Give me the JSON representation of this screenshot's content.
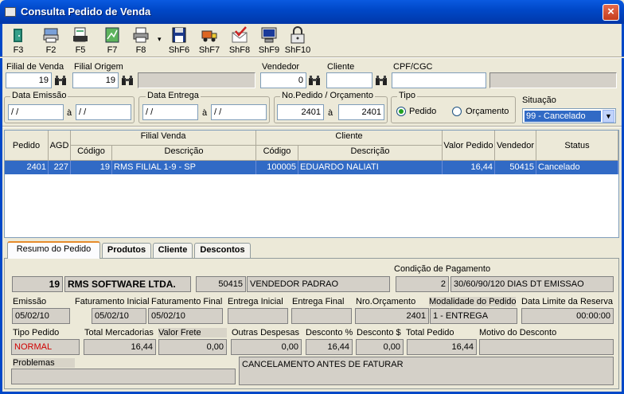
{
  "window": {
    "title": "Consulta Pedido de Venda",
    "close": "×"
  },
  "toolbar": [
    {
      "key": "F3",
      "icon": "exit-door-icon"
    },
    {
      "key": "F2",
      "icon": "printer-screen-icon"
    },
    {
      "key": "F5",
      "icon": "clear-page-icon"
    },
    {
      "key": "F7",
      "icon": "spreadsheet-icon"
    },
    {
      "key": "F8",
      "icon": "printer-icon"
    },
    {
      "key": "ShF6",
      "icon": "floppy-save-icon"
    },
    {
      "key": "ShF7",
      "icon": "delivery-truck-icon"
    },
    {
      "key": "ShF8",
      "icon": "check-mail-icon"
    },
    {
      "key": "ShF9",
      "icon": "computer-monitor-icon"
    },
    {
      "key": "ShF10",
      "icon": "padlock-icon"
    }
  ],
  "filters": {
    "filial_venda_label": "Filial de Venda",
    "filial_venda_value": "19",
    "filial_origem_label": "Filial Origem",
    "filial_origem_value": "19",
    "vendedor_label": "Vendedor",
    "vendedor_value": "0",
    "cliente_label": "Cliente",
    "cliente_value": "",
    "cpf_label": "CPF/CGC",
    "cpf_value": "",
    "data_emissao_label": "Data Emissão",
    "data_emissao_from": " / /",
    "data_emissao_to": " / /",
    "data_entrega_label": "Data Entrega",
    "data_entrega_from": " / /",
    "data_entrega_to": " / /",
    "a_sep": "à",
    "no_pedido_label": "No.Pedido / Orçamento",
    "no_pedido_from": "2401",
    "no_pedido_to": "2401",
    "tipo_label": "Tipo",
    "tipo_pedido": "Pedido",
    "tipo_orcamento": "Orçamento",
    "tipo_selected": "Pedido",
    "situacao_label": "Situação",
    "situacao_value": "99 - Cancelado"
  },
  "grid": {
    "headers": {
      "pedido": "Pedido",
      "agd": "AGD",
      "filial_venda": "Filial Venda",
      "codigo": "Código",
      "descricao": "Descrição",
      "cliente": "Cliente",
      "cliente_codigo": "Código",
      "cliente_descricao": "Descrição",
      "valor_pedido": "Valor Pedido",
      "vendedor": "Vendedor",
      "status": "Status"
    },
    "rows": [
      {
        "pedido": "2401",
        "agd": "227",
        "codigo": "19",
        "descricao": "RMS FILIAL 1-9 - SP",
        "cliente_codigo": "100005",
        "cliente_descricao": "EDUARDO NALIATI",
        "valor": "16,44",
        "vendedor": "50415",
        "status": "Cancelado"
      }
    ]
  },
  "tabs": [
    "Resumo do Pedido",
    "Produtos",
    "Cliente",
    "Descontos"
  ],
  "resumo": {
    "filial_num": "19",
    "filial_nome": "RMS SOFTWARE LTDA.",
    "vendedor_cod": "50415",
    "vendedor_nome": "VENDEDOR PADRAO",
    "condicao_label": "Condição de Pagamento",
    "condicao_cod": "2",
    "condicao_desc": "30/60/90/120 DIAS DT EMISSAO",
    "emissao_label": "Emissão",
    "emissao": "05/02/10",
    "fat_inicial_label": "Faturamento Inicial",
    "fat_inicial": "05/02/10",
    "fat_final_label": "Faturamento Final",
    "fat_final": "05/02/10",
    "entrega_inicial_label": "Entrega Inicial",
    "entrega_inicial": "",
    "entrega_final_label": "Entrega Final",
    "entrega_final": "",
    "nro_orc_label": "Nro.Orçamento",
    "nro_orc": "2401",
    "modalidade_label": "Modalidade do Pedido",
    "modalidade": "1 - ENTREGA",
    "data_limite_label": "Data Limite da Reserva",
    "data_limite": "00:00:00",
    "tipo_pedido_label": "Tipo Pedido",
    "tipo_pedido": "NORMAL",
    "total_merc_label": "Total Mercadorias",
    "total_merc": "16,44",
    "valor_frete_label": "Valor Frete",
    "valor_frete": "0,00",
    "outras_label": "Outras Despesas",
    "outras": "0,00",
    "desc_pct_label": "Desconto %",
    "desc_pct": "16,44",
    "desc_val_label": "Desconto $",
    "desc_val": "0,00",
    "total_pedido_label": "Total Pedido",
    "total_pedido": "16,44",
    "motivo_label": "Motivo do Desconto",
    "motivo": "",
    "problemas_label": "Problemas",
    "problemas": "",
    "observacao": "CANCELAMENTO ANTES DE FATURAR"
  },
  "colors": {
    "title_bar": "#0048c8",
    "selection": "#316ac5",
    "tipo_pedido_text": "#d00000"
  }
}
